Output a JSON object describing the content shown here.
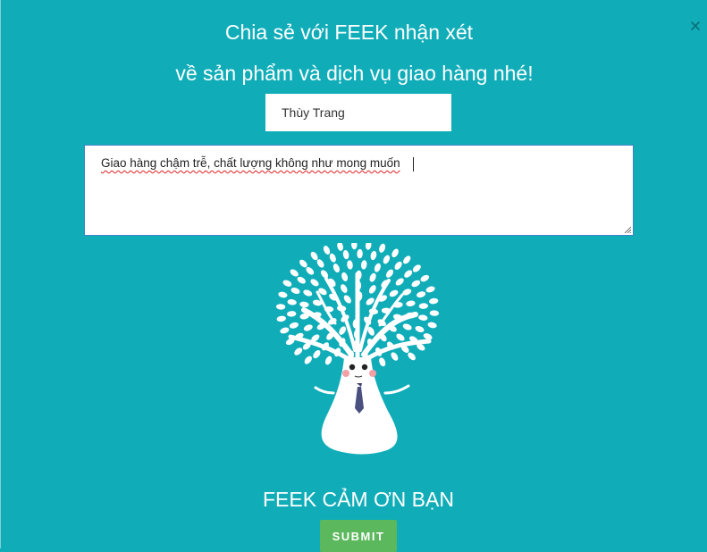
{
  "header": {
    "line1": "Chia sẻ với FEEK nhận xét",
    "line2": "về sản phẩm và dịch vụ giao hàng nhé!"
  },
  "form": {
    "name_value": "Thùy Trang",
    "message_value": "Giao hàng chậm trễ, chất lượng không như mong muốn",
    "submit_label": "SUBMIT"
  },
  "thanks": "FEEK CẢM ƠN BẠN",
  "icons": {
    "close": "close-icon",
    "mascot": "tree-mascot-illustration"
  },
  "colors": {
    "background": "#10adb9",
    "submit": "#5cb85c",
    "text": "#ffffff"
  }
}
